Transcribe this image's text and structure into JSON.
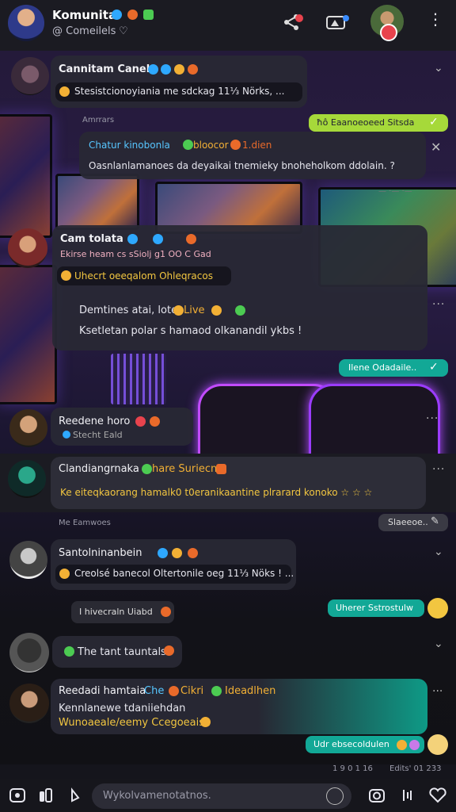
{
  "header": {
    "title": "Komunita",
    "subtitle": "@ Comeilels",
    "icons": [
      "share-icon",
      "camera-icon",
      "more-icon"
    ]
  },
  "messages": [
    {
      "name": "Cannitam Canela",
      "text": "Stesistcionoyiania me sdckag 11⅓ Nörks, ...",
      "time": ""
    },
    {
      "label": "Amrrars"
    },
    {
      "green": "ħô Eaanoeoeed Sitsda"
    },
    {
      "name": "Chatur kinobonla",
      "name2": "bloocor",
      "name3": "1.dien",
      "text": "Oasnlanlamanoes da deyaikai tnemieky bnoheholkom ddolain. ?"
    },
    {
      "name": "Cam tolata",
      "sub": "Ekirse heam cs sSiolj g1 OO C Gad",
      "quote": "Uhecrt oeeqalom Ohleqracos",
      "text1": "Demtines atai, lote",
      "text1b": "Live",
      "text2": "Ksetletan polar s hamaod olkanandil ykbs !"
    },
    {
      "teal": "Ilene Odadaile.."
    },
    {
      "name": "Reedene horo",
      "sub": "Stecht Eald"
    },
    {
      "name": "Clandiangrnaka",
      "name2": "hare Suriecn",
      "text": "Ke eiteqkaorang hamalk0 t0eranikaantine plrarard konoko ☆ ☆ ☆"
    },
    {
      "label": "Me Eamwoes"
    },
    {
      "gray": "Slaeeoe.."
    },
    {
      "name": "Santolninanbein",
      "text": "Creolsé banecol Oltertonile oeg 11⅓ Nöks ! ..."
    },
    {
      "pill": "I hivecraln Uiabd"
    },
    {
      "teal": "Uherer Sstrostulw"
    },
    {
      "pill": "The tant tauntals"
    },
    {
      "name": "Reedadi hamtaia",
      "name2": "Che",
      "name3": "Cikri",
      "name4": "Ideadlhen",
      "text1": "Kennlanewe tdaniiehdan",
      "text2": "Wunoaeale/eemy Ccegoeaise"
    },
    {
      "teal": "Udr ebsecoldulen"
    }
  ],
  "footer": {
    "left": "1 9 0 1 16",
    "right": "Edits' 01 233"
  },
  "input": {
    "placeholder": "Wykolvamenotatnos."
  },
  "theme": {
    "accent_green": "#a6d93a",
    "accent_teal": "#12a896",
    "bubble": "#282834",
    "header": "#1b1b22"
  }
}
